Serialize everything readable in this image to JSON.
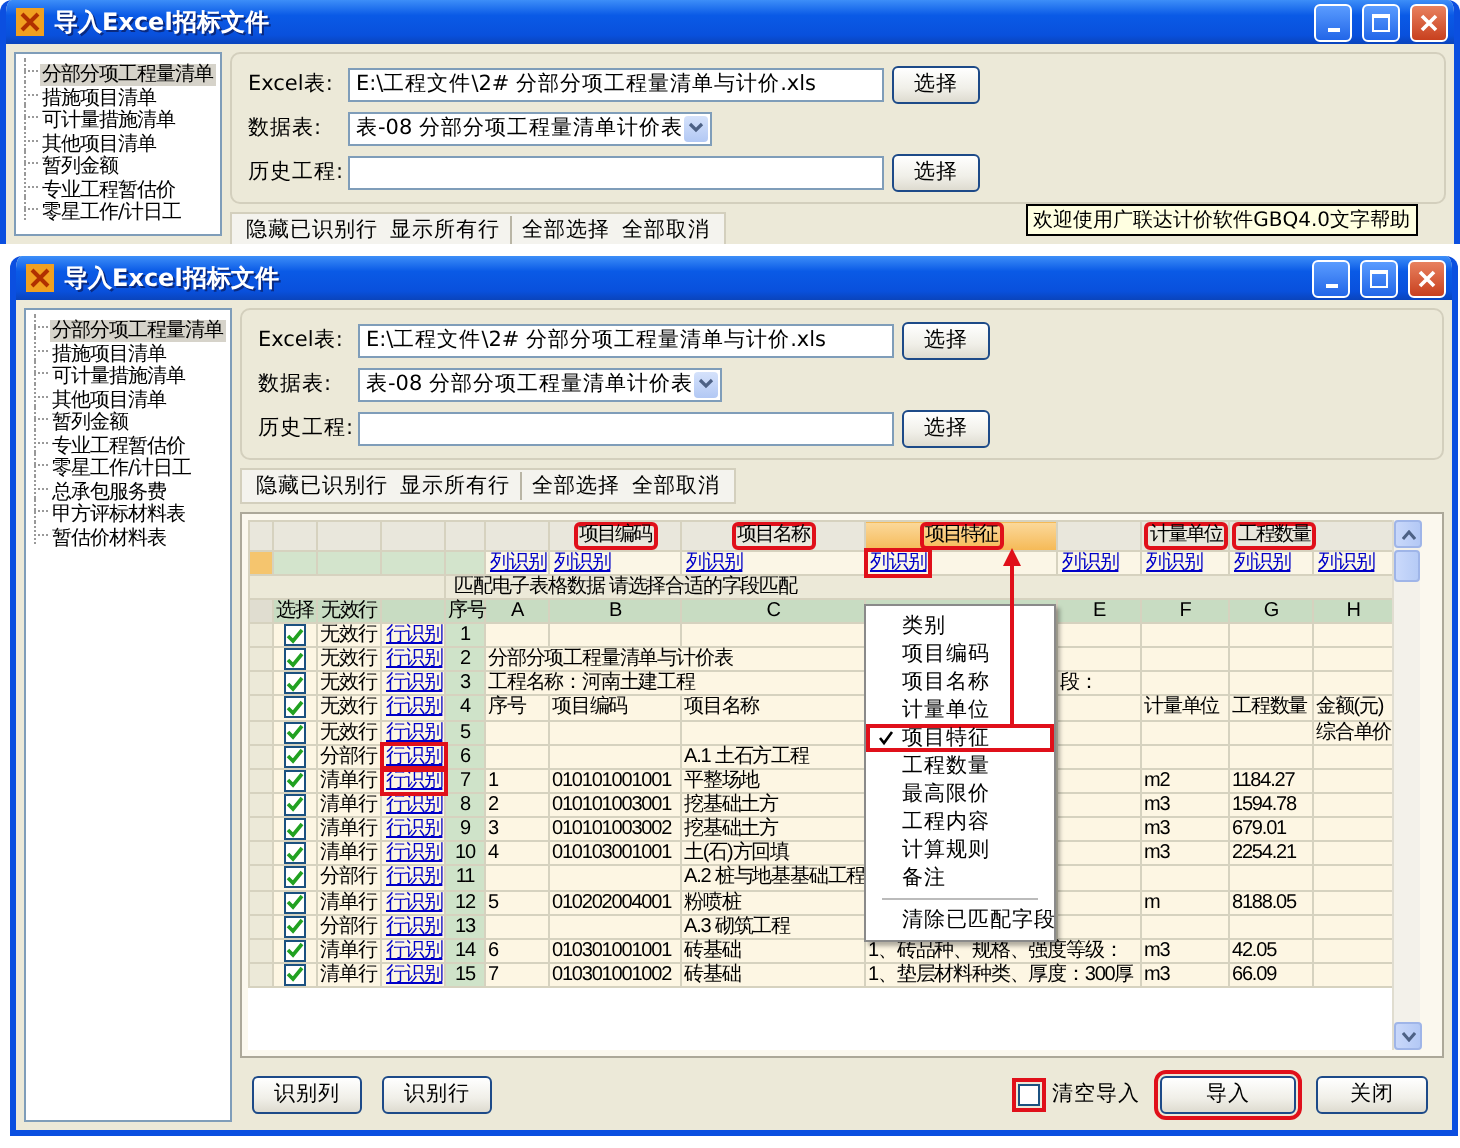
{
  "back_window": {
    "title": "导入Excel招标文件",
    "sidebar": [
      {
        "label": "分部分项工程量清单",
        "selected": true
      },
      {
        "label": "措施项目清单",
        "selected": false
      },
      {
        "label": "可计量措施清单",
        "selected": false
      },
      {
        "label": "其他项目清单",
        "selected": false
      },
      {
        "label": "暂列金额",
        "selected": false
      },
      {
        "label": "专业工程暂估价",
        "selected": false
      },
      {
        "label": "零星工作/计日工",
        "selected": false
      }
    ],
    "form": {
      "excel_label": "Excel表:",
      "excel_path": "E:\\工程文件\\2# 分部分项工程量清单与计价.xls",
      "excel_button": "选择",
      "sheet_label": "数据表:",
      "sheet_value": "表-08 分部分项工程量清单计价表",
      "history_label": "历史工程:",
      "history_button": "选择"
    },
    "toolbar": [
      [
        "隐藏已识别行",
        "显示所有行"
      ],
      [
        "全部选择",
        "全部取消"
      ]
    ],
    "tooltip": "欢迎使用广联达计价软件GBQ4.0文字帮助"
  },
  "window": {
    "title": "导入Excel招标文件",
    "sidebar": [
      {
        "label": "分部分项工程量清单",
        "selected": true
      },
      {
        "label": "措施项目清单",
        "selected": false
      },
      {
        "label": "可计量措施清单",
        "selected": false
      },
      {
        "label": "其他项目清单",
        "selected": false
      },
      {
        "label": "暂列金额",
        "selected": false
      },
      {
        "label": "专业工程暂估价",
        "selected": false
      },
      {
        "label": "零星工作/计日工",
        "selected": false
      },
      {
        "label": "总承包服务费",
        "selected": false
      },
      {
        "label": "甲方评标材料表",
        "selected": false
      },
      {
        "label": "暂估价材料表",
        "selected": false
      }
    ],
    "form": {
      "excel_label": "Excel表:",
      "excel_path": "E:\\工程文件\\2# 分部分项工程量清单与计价.xls",
      "excel_button": "选择",
      "sheet_label": "数据表:",
      "sheet_value": "表-08 分部分项工程量清单计价表",
      "history_label": "历史工程:",
      "history_button": "选择"
    },
    "toolbar": [
      [
        "隐藏已识别行",
        "显示所有行"
      ],
      [
        "全部选择",
        "全部取消"
      ]
    ],
    "grid": {
      "field_row": {
        "B": {
          "text": "项目编码",
          "highlighted": true,
          "selected": false
        },
        "C": {
          "text": "项目名称",
          "highlighted": true,
          "selected": false
        },
        "D": {
          "text": "项目特征",
          "highlighted": true,
          "selected": true
        },
        "F": {
          "text": "计量单位",
          "highlighted": true,
          "selected": false
        },
        "G": {
          "text": "工程数量",
          "highlighted": true,
          "selected": false
        }
      },
      "link_row": [
        {
          "text": "列识别",
          "highlighted": false
        },
        {
          "text": "列识别",
          "highlighted": false
        },
        {
          "text": "列识别",
          "highlighted": false
        },
        {
          "text": "列识别",
          "highlighted": true
        },
        {
          "text": "列识别",
          "highlighted": false
        },
        {
          "text": "列识别",
          "highlighted": false
        },
        {
          "text": "列识别",
          "highlighted": false
        },
        {
          "text": "列识别",
          "highlighted": false
        }
      ],
      "banner": "匹配电子表格数据 请选择合适的字段匹配",
      "header": {
        "select": "选择",
        "status": "无效行",
        "index": "序号",
        "columns": [
          "A",
          "B",
          "C",
          null,
          "E",
          "F",
          "G",
          "H"
        ]
      },
      "rows": [
        {
          "checked": true,
          "status": "无效行",
          "link": "行识别",
          "highlighted": false,
          "index": "1",
          "cells": [
            null,
            null,
            null,
            null,
            null,
            null,
            null,
            null
          ]
        },
        {
          "checked": true,
          "status": "无效行",
          "link": "行识别",
          "highlighted": false,
          "index": "2",
          "cells": [
            {
              "text": "分部分项工程量清单与计价表",
              "colspan": 3
            },
            null,
            null,
            null,
            null,
            null
          ]
        },
        {
          "checked": true,
          "status": "无效行",
          "link": "行识别",
          "highlighted": false,
          "index": "3",
          "cells": [
            {
              "text": "工程名称：河南土建工程",
              "colspan": 3
            },
            null,
            "段：",
            null,
            null,
            null
          ]
        },
        {
          "checked": true,
          "status": "无效行",
          "link": "行识别",
          "highlighted": false,
          "index": "4",
          "cells": [
            "序号",
            "项目编码",
            "项目名称",
            null,
            null,
            "计量单位",
            "工程数量",
            "金额(元)"
          ]
        },
        {
          "checked": true,
          "status": "无效行",
          "link": "行识别",
          "highlighted": false,
          "index": "5",
          "cells": [
            null,
            null,
            null,
            null,
            null,
            null,
            null,
            "综合单价"
          ]
        },
        {
          "checked": true,
          "status": "分部行",
          "link": "行识别",
          "highlighted": true,
          "index": "6",
          "cells": [
            null,
            null,
            "A.1 土石方工程",
            null,
            null,
            null,
            null,
            null
          ]
        },
        {
          "checked": true,
          "status": "清单行",
          "link": "行识别",
          "highlighted": true,
          "index": "7",
          "cells": [
            "1",
            "010101001001",
            "平整场地",
            null,
            null,
            "m2",
            "1184.27",
            null
          ]
        },
        {
          "checked": true,
          "status": "清单行",
          "link": "行识别",
          "highlighted": false,
          "index": "8",
          "cells": [
            "2",
            "010101003001",
            "挖基础土方",
            null,
            null,
            "m3",
            "1594.78",
            null
          ]
        },
        {
          "checked": true,
          "status": "清单行",
          "link": "行识别",
          "highlighted": false,
          "index": "9",
          "cells": [
            "3",
            "010101003002",
            "挖基础土方",
            null,
            null,
            "m3",
            "679.01",
            null
          ]
        },
        {
          "checked": true,
          "status": "清单行",
          "link": "行识别",
          "highlighted": false,
          "index": "10",
          "cells": [
            "4",
            "010103001001",
            "土(石)方回填",
            null,
            null,
            "m3",
            "2254.21",
            null
          ]
        },
        {
          "checked": true,
          "status": "分部行",
          "link": "行识别",
          "highlighted": false,
          "index": "11",
          "cells": [
            null,
            null,
            "A.2 桩与地基基础工程",
            null,
            null,
            null,
            null,
            null
          ]
        },
        {
          "checked": true,
          "status": "清单行",
          "link": "行识别",
          "highlighted": false,
          "index": "12",
          "cells": [
            "5",
            "010202004001",
            "粉喷桩",
            null,
            null,
            "m",
            "8188.05",
            null
          ]
        },
        {
          "checked": true,
          "status": "分部行",
          "link": "行识别",
          "highlighted": false,
          "index": "13",
          "cells": [
            null,
            null,
            "A.3 砌筑工程",
            null,
            null,
            null,
            null,
            null
          ]
        },
        {
          "checked": true,
          "status": "清单行",
          "link": "行识别",
          "highlighted": false,
          "index": "14",
          "cells": [
            "6",
            "010301001001",
            "砖基础",
            {
              "text": "1、砖品种、规格、强度等级：",
              "colspan": 2
            },
            "m3",
            "42.05",
            null
          ]
        },
        {
          "checked": true,
          "status": "清单行",
          "link": "行识别",
          "highlighted": false,
          "index": "15",
          "cells": [
            "7",
            "010301001002",
            "砖基础",
            {
              "text": "1、垫层材料种类、厚度：300厚",
              "colspan": 2
            },
            "m3",
            "66.09",
            null
          ]
        }
      ]
    },
    "menu": {
      "items": [
        {
          "label": "类别",
          "checked": false,
          "highlighted": false
        },
        {
          "label": "项目编码",
          "checked": false,
          "highlighted": false
        },
        {
          "label": "项目名称",
          "checked": false,
          "highlighted": false
        },
        {
          "label": "计量单位",
          "checked": false,
          "highlighted": false
        },
        {
          "label": "项目特征",
          "checked": true,
          "highlighted": true
        },
        {
          "label": "工程数量",
          "checked": false,
          "highlighted": false
        },
        {
          "label": "最高限价",
          "checked": false,
          "highlighted": false
        },
        {
          "label": "工程内容",
          "checked": false,
          "highlighted": false
        },
        {
          "label": "计算规则",
          "checked": false,
          "highlighted": false
        },
        {
          "label": "备注",
          "checked": false,
          "highlighted": false
        }
      ],
      "clear": "清除已匹配字段"
    },
    "footer": {
      "buttons": [
        "识别列",
        "识别行"
      ],
      "clear_import": {
        "label": "清空导入",
        "checked": false,
        "highlighted": true
      },
      "import": {
        "label": "导入",
        "highlighted": true
      },
      "close": "关闭"
    }
  }
}
